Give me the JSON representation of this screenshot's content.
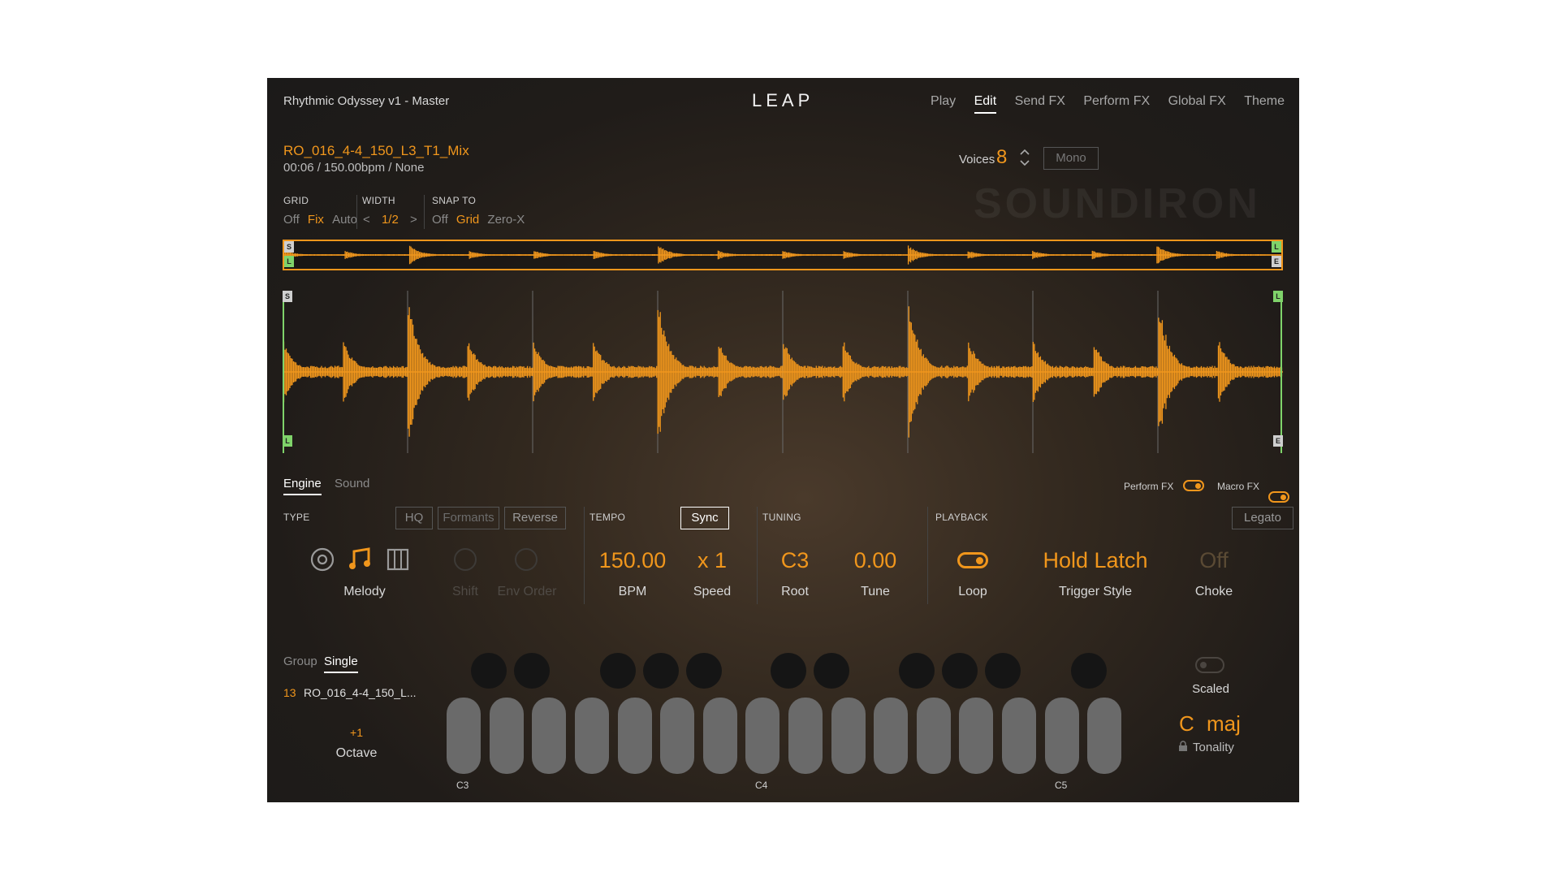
{
  "header": {
    "preset_title": "Rhythmic Odyssey v1 - Master",
    "logo": "LEAP",
    "nav": [
      {
        "label": "Play",
        "active": false
      },
      {
        "label": "Edit",
        "active": true
      },
      {
        "label": "Send FX",
        "active": false
      },
      {
        "label": "Perform FX",
        "active": false
      },
      {
        "label": "Global FX",
        "active": false
      },
      {
        "label": "Theme",
        "active": false
      }
    ]
  },
  "sample": {
    "name": "RO_016_4-4_150_L3_T1_Mix",
    "info": "00:06 / 150.00bpm / None"
  },
  "voices": {
    "label": "Voices",
    "value": "8",
    "mono_label": "Mono"
  },
  "watermark": "SOUNDIRON",
  "grid": {
    "label": "GRID",
    "options": [
      "Off",
      "Fix",
      "Auto"
    ],
    "selected": "Fix"
  },
  "width": {
    "label": "WIDTH",
    "value": "1/2",
    "prev": "<",
    "next": ">"
  },
  "snap": {
    "label": "SNAP TO",
    "options": [
      "Off",
      "Grid",
      "Zero-X"
    ],
    "selected": "Grid"
  },
  "markers": {
    "start": "S",
    "loop": "L",
    "end": "E"
  },
  "tabs": {
    "engine": "Engine",
    "sound": "Sound"
  },
  "fx_toggles": {
    "perform_fx": "Perform FX",
    "macro_fx": "Macro FX"
  },
  "type": {
    "label": "TYPE",
    "hq": "HQ",
    "formants": "Formants",
    "reverse": "Reverse",
    "mode_label": "Melody",
    "shift_label": "Shift",
    "env_order_label": "Env Order"
  },
  "tempo": {
    "label": "TEMPO",
    "sync": "Sync",
    "bpm_value": "150.00",
    "bpm_label": "BPM",
    "speed_value": "x 1",
    "speed_label": "Speed"
  },
  "tuning": {
    "label": "TUNING",
    "root_value": "C3",
    "root_label": "Root",
    "tune_value": "0.00",
    "tune_label": "Tune"
  },
  "playback": {
    "label": "PLAYBACK",
    "legato": "Legato",
    "loop_label": "Loop",
    "trigger_value": "Hold Latch",
    "trigger_label": "Trigger Style",
    "choke_value": "Off",
    "choke_label": "Choke"
  },
  "slices": {
    "group_tab": "Group",
    "single_tab": "Single",
    "index": "13",
    "name": "RO_016_4-4_150_L...",
    "octave_value": "+1",
    "octave_label": "Octave"
  },
  "keyboard": {
    "labels": [
      "C3",
      "C4",
      "C5"
    ]
  },
  "scale": {
    "scaled_label": "Scaled",
    "key": "C",
    "mode": "maj",
    "tonality_label": "Tonality"
  },
  "colors": {
    "accent": "#f0961c",
    "loop_marker": "#7fd36a",
    "panel": "#1e1c1a"
  }
}
